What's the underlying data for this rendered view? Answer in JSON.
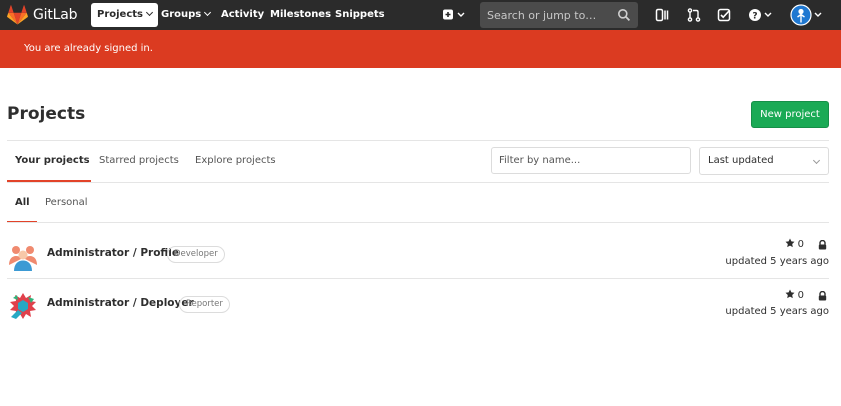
{
  "nav": {
    "brand": "GitLab",
    "items": [
      {
        "label": "Projects",
        "active": true,
        "dropdown": true
      },
      {
        "label": "Groups",
        "active": false,
        "dropdown": true
      },
      {
        "label": "Activity",
        "active": false,
        "dropdown": false
      },
      {
        "label": "Milestones",
        "active": false,
        "dropdown": false
      },
      {
        "label": "Snippets",
        "active": false,
        "dropdown": false
      }
    ],
    "search_placeholder": "Search or jump to…",
    "icons": [
      "plus-icon",
      "search-icon",
      "issues-icon",
      "merge-request-icon",
      "todo-icon",
      "help-icon",
      "user-avatar"
    ]
  },
  "flash": {
    "message": "You are already signed in."
  },
  "header": {
    "title": "Projects",
    "new_button": "New project"
  },
  "tabs": [
    {
      "label": "Your projects",
      "active": true
    },
    {
      "label": "Starred projects",
      "active": false
    },
    {
      "label": "Explore projects",
      "active": false
    }
  ],
  "filter": {
    "placeholder": "Filter by name..."
  },
  "sort": {
    "selected": "Last updated"
  },
  "subtabs": [
    {
      "label": "All",
      "active": true
    },
    {
      "label": "Personal",
      "active": false
    }
  ],
  "projects": [
    {
      "name": "Administrator / Profile",
      "role": "Developer",
      "stars": "0",
      "updated": "updated 5 years ago",
      "private": true
    },
    {
      "name": "Administrator / Deployer",
      "role": "Reporter",
      "stars": "0",
      "updated": "updated 5 years ago",
      "private": true
    }
  ],
  "colors": {
    "navbar": "#2b2b2b",
    "flash": "#db3b21",
    "accent": "#e24329",
    "success": "#1aaa55"
  }
}
